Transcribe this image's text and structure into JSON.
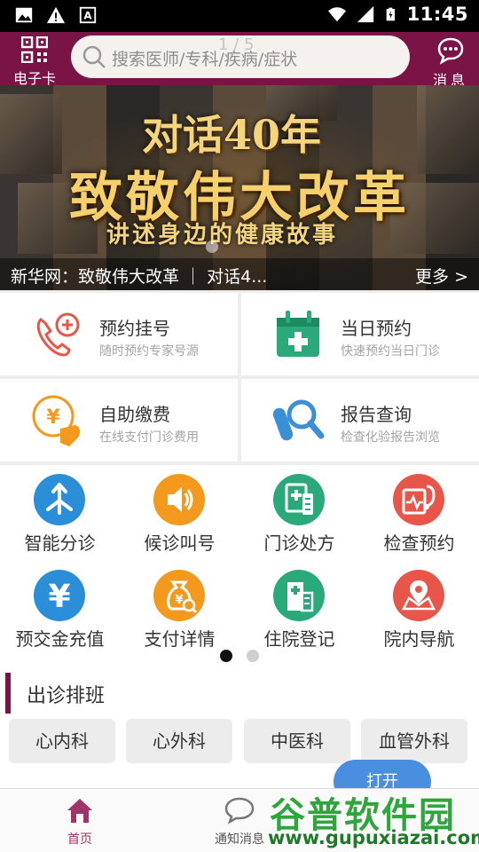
{
  "status_bar": {
    "time": "11:45",
    "left_icons": [
      "image-icon",
      "warning-icon",
      "a-box-icon"
    ],
    "right_icons": [
      "wifi-icon",
      "signal-icon",
      "battery-charging-icon"
    ]
  },
  "header": {
    "ecard_label": "电子卡",
    "search_placeholder": "搜索医师/专科/疾病/症状",
    "page_indicator": "1 / 5",
    "message_label": "消息",
    "bg_color": "#7a1346"
  },
  "banner": {
    "title_line1": "对话40年",
    "title_line2": "致敬伟大改革",
    "title_line3": "讲述身边的健康故事",
    "caption": "新华网：致敬伟大改革 ｜ 对话4...",
    "more_label": "更多 >"
  },
  "quick_cards": [
    {
      "title": "预约挂号",
      "sub": "随时预约专家号源",
      "icon": "phone-plus-icon"
    },
    {
      "title": "当日预约",
      "sub": "快速预约当日门诊",
      "icon": "calendar-cross-icon"
    },
    {
      "title": "自助缴费",
      "sub": "在线支付门诊费用",
      "icon": "yen-hand-icon"
    },
    {
      "title": "报告查询",
      "sub": "检查化验报告浏览",
      "icon": "test-tube-search-icon"
    }
  ],
  "services": [
    {
      "label": "智能分诊",
      "icon": "triage-arrows-icon",
      "color": "#2a8fd8"
    },
    {
      "label": "候诊叫号",
      "icon": "speaker-icon",
      "color": "#f39a1e"
    },
    {
      "label": "门诊处方",
      "icon": "prescription-icon",
      "color": "#2aa97a"
    },
    {
      "label": "检查预约",
      "icon": "stethoscope-icon",
      "color": "#e8564a"
    },
    {
      "label": "预交金充值",
      "icon": "yen-icon",
      "color": "#2a8fd8"
    },
    {
      "label": "支付详情",
      "icon": "money-bag-icon",
      "color": "#f39a1e"
    },
    {
      "label": "住院登记",
      "icon": "hospital-icon",
      "color": "#2aa97a"
    },
    {
      "label": "院内导航",
      "icon": "map-pin-icon",
      "color": "#e8564a"
    }
  ],
  "schedule": {
    "header": "出诊排班",
    "departments": [
      "心内科",
      "心外科",
      "中医科",
      "血管外科"
    ],
    "float_button": "打开"
  },
  "tabbar": {
    "home_label": "首页",
    "notice_label": "通知消息"
  },
  "watermark": {
    "line1": "谷普软件园",
    "line2": "www.gupuxiazai.com"
  }
}
